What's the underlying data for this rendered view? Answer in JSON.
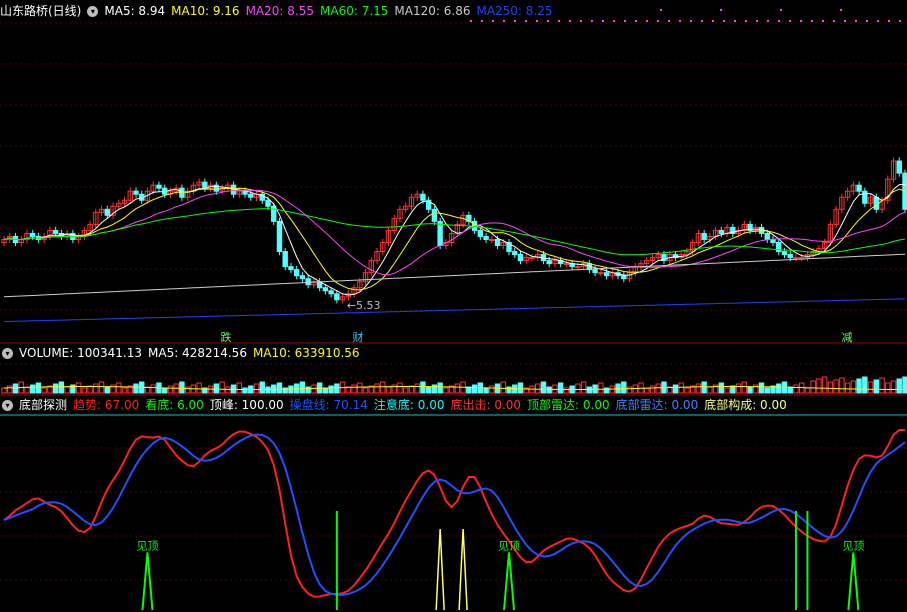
{
  "price_panel": {
    "title": "山东路桥(日线)",
    "ma": [
      {
        "label": "MA5: 8.94",
        "color": "#ffffff"
      },
      {
        "label": "MA10: 9.16",
        "color": "#ffff00"
      },
      {
        "label": "MA20: 8.55",
        "color": "#ff40ff"
      },
      {
        "label": "MA60: 7.15",
        "color": "#00ff00"
      },
      {
        "label": "MA120: 6.86",
        "color": "#cccccc"
      },
      {
        "label": "MA250: 8.25",
        "color": "#2040ff"
      }
    ],
    "low_label": "5.53",
    "markers": [
      {
        "text": "跌",
        "color": "#60ff60"
      },
      {
        "text": "财",
        "color": "#40c0ff"
      },
      {
        "text": "减",
        "color": "#60ff60"
      }
    ]
  },
  "volume_panel": {
    "labels": [
      {
        "text": "VOLUME: 100341.13",
        "color": "#ffffff"
      },
      {
        "text": "MA5: 428214.56",
        "color": "#ffffff"
      },
      {
        "text": "MA10: 633910.56",
        "color": "#ffff00"
      }
    ]
  },
  "indicator_panel": {
    "title": "底部探测",
    "items": [
      {
        "text": "趋势: 67.00",
        "color": "#ff2020"
      },
      {
        "text": "看底: 6.00",
        "color": "#00ff00"
      },
      {
        "text": "顶峰: 100.00",
        "color": "#ffffff"
      },
      {
        "text": "操盘线: 70.14",
        "color": "#2050ff"
      },
      {
        "text": "注意底: 0.00",
        "color": "#00ffff"
      },
      {
        "text": "底出击: 0.00",
        "color": "#ff3030"
      },
      {
        "text": "顶部雷达: 0.00",
        "color": "#00ff00"
      },
      {
        "text": "底部雷达: 0.00",
        "color": "#4080ff"
      },
      {
        "text": "底部构成: 0.00",
        "color": "#ffff80"
      }
    ],
    "signal_label": "见顶"
  },
  "chart_data": {
    "type": "line",
    "price_close": [
      8.0,
      8.1,
      7.9,
      8.0,
      8.2,
      8.1,
      8.0,
      8.1,
      8.3,
      8.2,
      8.1,
      8.2,
      8.0,
      8.1,
      8.3,
      8.5,
      8.9,
      9.0,
      8.8,
      9.1,
      9.2,
      9.3,
      9.6,
      9.5,
      9.3,
      9.6,
      9.8,
      9.7,
      9.5,
      9.6,
      9.7,
      9.4,
      9.6,
      9.8,
      9.9,
      9.7,
      9.8,
      9.6,
      9.7,
      9.8,
      9.5,
      9.6,
      9.5,
      9.4,
      9.5,
      9.3,
      9.1,
      8.6,
      7.6,
      7.1,
      7.0,
      6.8,
      6.7,
      6.5,
      6.6,
      6.4,
      6.3,
      6.2,
      6.0,
      6.1,
      6.2,
      6.4,
      6.6,
      6.9,
      7.3,
      7.6,
      7.9,
      8.3,
      8.7,
      9.0,
      9.1,
      9.4,
      9.5,
      9.3,
      9.0,
      8.6,
      7.8,
      7.9,
      8.2,
      8.5,
      8.8,
      8.6,
      8.3,
      8.1,
      8.0,
      8.0,
      7.8,
      7.9,
      7.6,
      7.5,
      7.3,
      7.4,
      7.4,
      7.5,
      7.3,
      7.2,
      7.3,
      7.2,
      7.2,
      7.1,
      7.1,
      7.2,
      7.0,
      6.9,
      6.9,
      6.8,
      6.9,
      6.8,
      6.7,
      6.9,
      7.1,
      7.2,
      7.3,
      7.4,
      7.5,
      7.3,
      7.5,
      7.4,
      7.5,
      7.6,
      7.9,
      8.2,
      8.0,
      8.1,
      8.3,
      8.2,
      8.4,
      8.2,
      8.3,
      8.5,
      8.3,
      8.4,
      8.2,
      8.0,
      7.9,
      7.6,
      7.5,
      7.4,
      7.4,
      7.4,
      7.5,
      7.6,
      7.7,
      7.9,
      8.5,
      9.0,
      9.4,
      9.6,
      9.8,
      9.6,
      9.2,
      9.4,
      9.0,
      9.3,
      10.0,
      10.6,
      10.2,
      9.0
    ],
    "series": [
      {
        "name": "趋势",
        "color": "#ff2020"
      },
      {
        "name": "操盘线",
        "color": "#2050ff"
      },
      {
        "name": "顶部雷达",
        "color": "#00ff00"
      }
    ],
    "legend": "top-left"
  }
}
